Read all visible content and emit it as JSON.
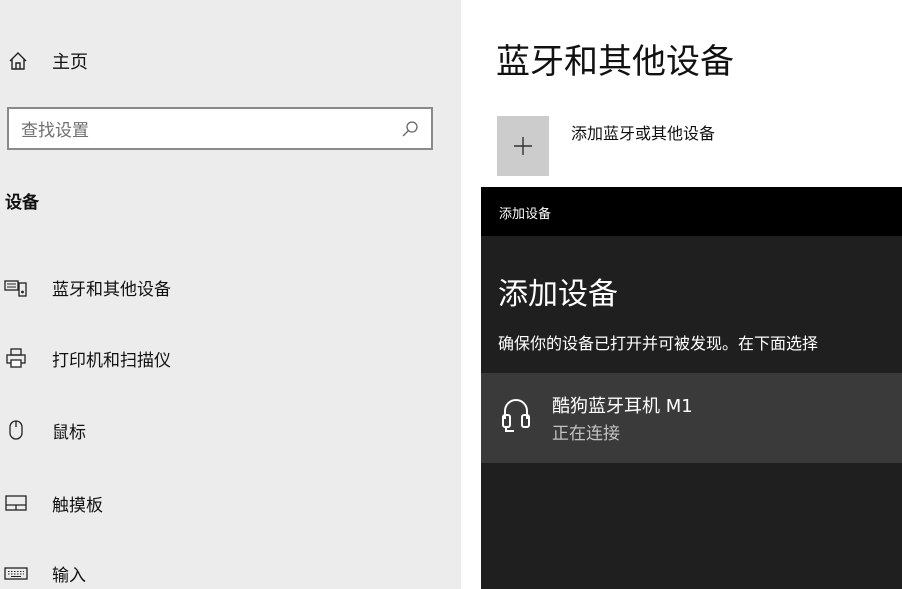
{
  "sidebar": {
    "home_label": "主页",
    "search_placeholder": "查找设置",
    "section_title": "设备",
    "items": [
      {
        "label": "蓝牙和其他设备",
        "icon": "bluetooth-devices-icon"
      },
      {
        "label": "打印机和扫描仪",
        "icon": "printer-icon"
      },
      {
        "label": "鼠标",
        "icon": "mouse-icon"
      },
      {
        "label": "触摸板",
        "icon": "touchpad-icon"
      },
      {
        "label": "输入",
        "icon": "keyboard-icon"
      }
    ]
  },
  "main": {
    "title": "蓝牙和其他设备",
    "add_label": "添加蓝牙或其他设备",
    "add_icon": "plus-icon"
  },
  "dialog": {
    "window_title": "添加设备",
    "heading": "添加设备",
    "description": "确保你的设备已打开并可被发现。在下面选择",
    "device": {
      "name": "酷狗蓝牙耳机 M1",
      "status": "正在连接",
      "icon": "headphones-icon"
    }
  },
  "colors": {
    "sidebar_bg": "#ececec",
    "dialog_bg": "#1f1f1f",
    "device_row_bg": "#3a3a3a",
    "titlebar_bg": "#000000"
  }
}
